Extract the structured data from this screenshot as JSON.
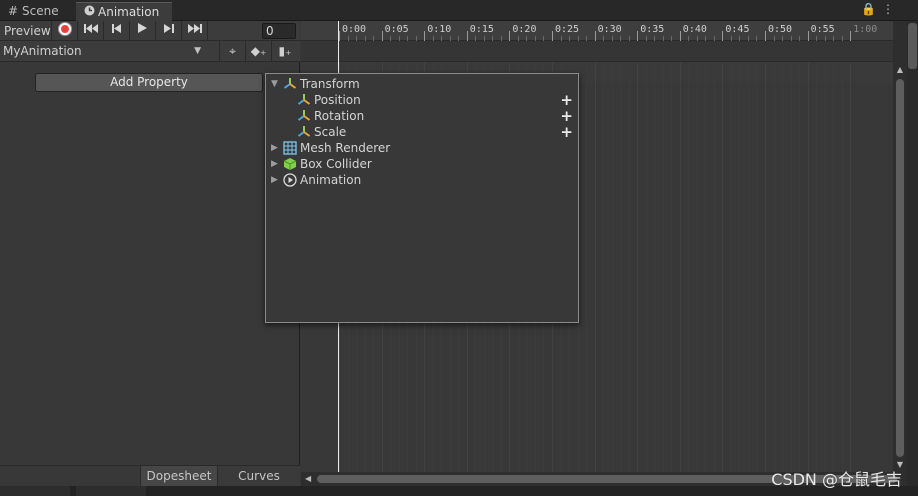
{
  "tabs": {
    "scene": "Scene",
    "animation": "Animation"
  },
  "toolbar": {
    "preview_label": "Preview",
    "frame_value": "0",
    "clip_name": "MyAnimation"
  },
  "left": {
    "add_property_label": "Add Property",
    "bottom_tabs": [
      "Dopesheet",
      "Curves"
    ]
  },
  "ruler": {
    "ticks": [
      "0:00",
      "0:05",
      "0:10",
      "0:15",
      "0:20",
      "0:25",
      "0:30",
      "0:35",
      "0:40",
      "0:45",
      "0:50",
      "0:55",
      "1:00"
    ]
  },
  "popup": {
    "items": [
      {
        "label": "Transform",
        "expanded": true,
        "icon": "transform-icon"
      },
      {
        "label": "Position",
        "child": true,
        "icon": "transform-icon"
      },
      {
        "label": "Rotation",
        "child": true,
        "icon": "transform-icon"
      },
      {
        "label": "Scale",
        "child": true,
        "icon": "transform-icon"
      },
      {
        "label": "Mesh Renderer",
        "expanded": false,
        "icon": "mesh-renderer-icon"
      },
      {
        "label": "Box Collider",
        "expanded": false,
        "icon": "box-collider-icon"
      },
      {
        "label": "Animation",
        "expanded": false,
        "icon": "animation-component-icon"
      }
    ]
  },
  "watermark": "CSDN @仓鼠毛吉",
  "colors": {
    "record": "#e2463b",
    "background": "#383838",
    "accent_green": "#7fd14a"
  }
}
